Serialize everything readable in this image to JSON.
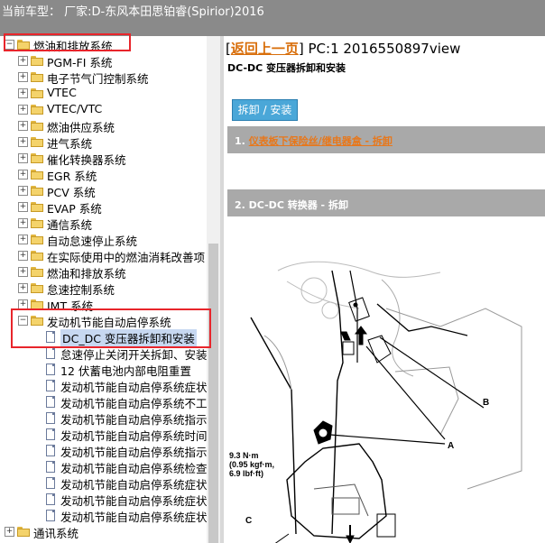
{
  "topbar": {
    "label": "当前车型： 厂家:D-东风本田思铂睿(Spirior)2016"
  },
  "tree": {
    "items": [
      {
        "label": "燃油和排放系统",
        "level": 0,
        "type": "folder",
        "expander": "⊟"
      },
      {
        "label": "PGM-FI 系统",
        "level": 1,
        "type": "folder",
        "expander": "+"
      },
      {
        "label": "电子节气门控制系统",
        "level": 1,
        "type": "folder",
        "expander": "+"
      },
      {
        "label": "VTEC",
        "level": 1,
        "type": "folder",
        "expander": "+"
      },
      {
        "label": "VTEC/VTC",
        "level": 1,
        "type": "folder",
        "expander": "+"
      },
      {
        "label": "燃油供应系统",
        "level": 1,
        "type": "folder",
        "expander": "+"
      },
      {
        "label": "进气系统",
        "level": 1,
        "type": "folder",
        "expander": "+"
      },
      {
        "label": "催化转换器系统",
        "level": 1,
        "type": "folder",
        "expander": "+"
      },
      {
        "label": "EGR 系统",
        "level": 1,
        "type": "folder",
        "expander": "+"
      },
      {
        "label": "PCV 系统",
        "level": 1,
        "type": "folder",
        "expander": "+"
      },
      {
        "label": "EVAP 系统",
        "level": 1,
        "type": "folder",
        "expander": "+"
      },
      {
        "label": "通信系统",
        "level": 1,
        "type": "folder",
        "expander": "+"
      },
      {
        "label": "自动怠速停止系统",
        "level": 1,
        "type": "folder",
        "expander": "+"
      },
      {
        "label": "在实际使用中的燃油消耗改善项",
        "level": 1,
        "type": "folder",
        "expander": "+"
      },
      {
        "label": "燃油和排放系统",
        "level": 1,
        "type": "folder",
        "expander": "+"
      },
      {
        "label": "怠速控制系统",
        "level": 1,
        "type": "folder",
        "expander": "+"
      },
      {
        "label": "IMT 系统",
        "level": 1,
        "type": "folder",
        "expander": "+"
      },
      {
        "label": "发动机节能自动启停系统",
        "level": 1,
        "type": "folder",
        "expander": "−"
      },
      {
        "label": "DC_DC 变压器拆卸和安装",
        "level": 2,
        "type": "doc",
        "selected": true
      },
      {
        "label": "怠速停止关闭开关拆卸、安装",
        "level": 2,
        "type": "doc"
      },
      {
        "label": "12 伏蓄电池内部电阻重置",
        "level": 2,
        "type": "doc"
      },
      {
        "label": "发动机节能自动启停系统症状",
        "level": 2,
        "type": "doc"
      },
      {
        "label": "发动机节能自动启停系统不工作",
        "level": 2,
        "type": "doc"
      },
      {
        "label": "发动机节能自动启停系统指示灯",
        "level": 2,
        "type": "doc"
      },
      {
        "label": "发动机节能自动启停系统时间",
        "level": 2,
        "type": "doc"
      },
      {
        "label": "发动机节能自动启停系统指示",
        "level": 2,
        "type": "doc"
      },
      {
        "label": "发动机节能自动启停系统检查",
        "level": 2,
        "type": "doc"
      },
      {
        "label": "发动机节能自动启停系统症状",
        "level": 2,
        "type": "doc"
      },
      {
        "label": "发动机节能自动启停系统症状",
        "level": 2,
        "type": "doc"
      },
      {
        "label": "发动机节能自动启停系统症状",
        "level": 2,
        "type": "doc"
      },
      {
        "label": "通讯系统",
        "level": 0,
        "type": "folder",
        "expander": "+"
      }
    ]
  },
  "content": {
    "back_link": "返回上一页",
    "page_code": "PC:1 2016550897view",
    "page_title": "DC-DC 变压器拆卸和安装",
    "button": "拆卸 / 安装",
    "step1_prefix": "1.",
    "step1_link": "仪表板下保险丝/继电器盒 - 拆卸",
    "step2": "2. DC-DC 转换器 - 拆卸",
    "callout_a": "A",
    "callout_b": "B",
    "callout_c": "C",
    "torque_1": "9.3 N·m",
    "torque_2": "(0.95 kgf·m,",
    "torque_3": "6.9 lbf·ft)"
  },
  "colors": {
    "topbar": "#8a8a8a",
    "accent_orange": "#d86e0a",
    "button_blue": "#4aa7d8",
    "step_bar": "#a9a9a9",
    "highlight_red": "#e8252b"
  }
}
